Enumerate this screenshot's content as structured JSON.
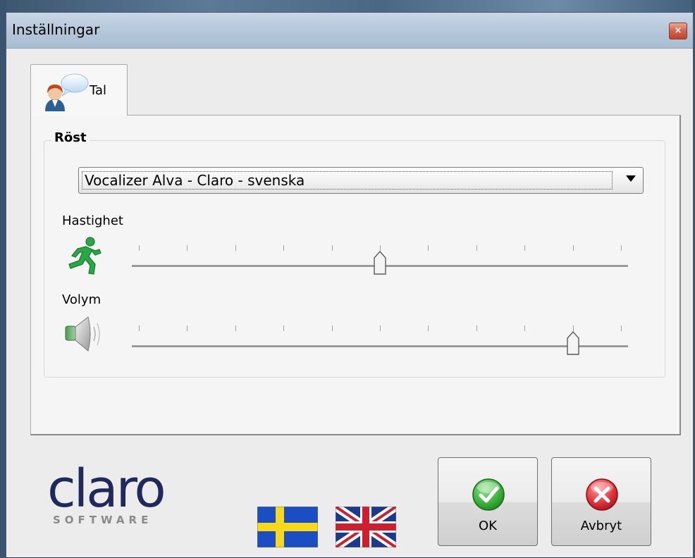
{
  "window": {
    "title": "Inställningar",
    "close_symbol": "×"
  },
  "tabs": [
    {
      "label": "Tal",
      "icon": "person-speech-bubble-icon"
    }
  ],
  "voice_group": {
    "title": "Röst",
    "voice_combo": {
      "value": "Vocalizer Alva - Claro - svenska"
    }
  },
  "speed": {
    "label": "Hastighet",
    "icon": "running-man-icon",
    "value_fraction": 0.5,
    "tick_count": 11
  },
  "volume": {
    "label": "Volym",
    "icon": "speaker-icon",
    "value_fraction": 0.9,
    "tick_count": 11
  },
  "footer": {
    "logo_text": "claro",
    "logo_sub": "SOFTWARE",
    "languages": [
      "Swedish flag",
      "British flag"
    ]
  },
  "buttons": {
    "ok_label": "OK",
    "cancel_label": "Avbryt"
  },
  "colors": {
    "ok_green": "#3bb33b",
    "cancel_red": "#e0323a",
    "logo_blue": "#1f2a5c"
  }
}
